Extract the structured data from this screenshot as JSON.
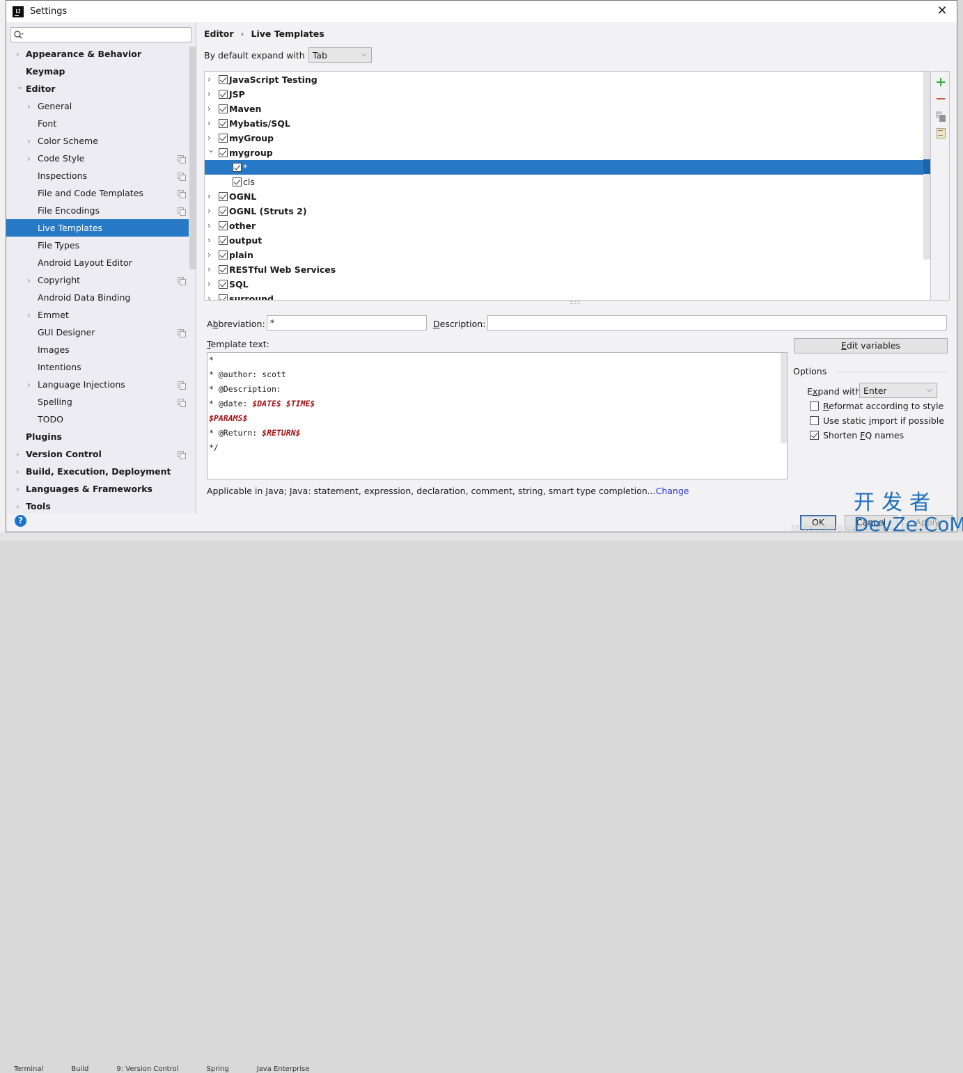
{
  "window": {
    "title": "Settings",
    "app_icon_text": "IJ",
    "close_glyph": "✕"
  },
  "sidebar": {
    "search_placeholder": "",
    "items": [
      {
        "label": "Appearance & Behavior",
        "level": 0,
        "bold": true,
        "arrow": "collapsed",
        "project_icon": false
      },
      {
        "label": "Keymap",
        "level": 0,
        "bold": true,
        "arrow": "none",
        "project_icon": false
      },
      {
        "label": "Editor",
        "level": 0,
        "bold": true,
        "arrow": "expanded",
        "project_icon": false
      },
      {
        "label": "General",
        "level": 1,
        "bold": false,
        "arrow": "collapsed",
        "project_icon": false
      },
      {
        "label": "Font",
        "level": 1,
        "bold": false,
        "arrow": "none",
        "project_icon": false
      },
      {
        "label": "Color Scheme",
        "level": 1,
        "bold": false,
        "arrow": "collapsed",
        "project_icon": false
      },
      {
        "label": "Code Style",
        "level": 1,
        "bold": false,
        "arrow": "collapsed",
        "project_icon": true
      },
      {
        "label": "Inspections",
        "level": 1,
        "bold": false,
        "arrow": "none",
        "project_icon": true
      },
      {
        "label": "File and Code Templates",
        "level": 1,
        "bold": false,
        "arrow": "none",
        "project_icon": true
      },
      {
        "label": "File Encodings",
        "level": 1,
        "bold": false,
        "arrow": "none",
        "project_icon": true
      },
      {
        "label": "Live Templates",
        "level": 1,
        "bold": false,
        "arrow": "none",
        "project_icon": false,
        "selected": true
      },
      {
        "label": "File Types",
        "level": 1,
        "bold": false,
        "arrow": "none",
        "project_icon": false
      },
      {
        "label": "Android Layout Editor",
        "level": 1,
        "bold": false,
        "arrow": "none",
        "project_icon": false
      },
      {
        "label": "Copyright",
        "level": 1,
        "bold": false,
        "arrow": "collapsed",
        "project_icon": true
      },
      {
        "label": "Android Data Binding",
        "level": 1,
        "bold": false,
        "arrow": "none",
        "project_icon": false
      },
      {
        "label": "Emmet",
        "level": 1,
        "bold": false,
        "arrow": "collapsed",
        "project_icon": false
      },
      {
        "label": "GUI Designer",
        "level": 1,
        "bold": false,
        "arrow": "none",
        "project_icon": true
      },
      {
        "label": "Images",
        "level": 1,
        "bold": false,
        "arrow": "none",
        "project_icon": false
      },
      {
        "label": "Intentions",
        "level": 1,
        "bold": false,
        "arrow": "none",
        "project_icon": false
      },
      {
        "label": "Language Injections",
        "level": 1,
        "bold": false,
        "arrow": "collapsed",
        "project_icon": true
      },
      {
        "label": "Spelling",
        "level": 1,
        "bold": false,
        "arrow": "none",
        "project_icon": true
      },
      {
        "label": "TODO",
        "level": 1,
        "bold": false,
        "arrow": "none",
        "project_icon": false
      },
      {
        "label": "Plugins",
        "level": 0,
        "bold": true,
        "arrow": "none",
        "project_icon": false
      },
      {
        "label": "Version Control",
        "level": 0,
        "bold": true,
        "arrow": "collapsed",
        "project_icon": true
      },
      {
        "label": "Build, Execution, Deployment",
        "level": 0,
        "bold": true,
        "arrow": "collapsed",
        "project_icon": false
      },
      {
        "label": "Languages & Frameworks",
        "level": 0,
        "bold": true,
        "arrow": "collapsed",
        "project_icon": false
      },
      {
        "label": "Tools",
        "level": 0,
        "bold": true,
        "arrow": "collapsed",
        "project_icon": false
      }
    ],
    "help_glyph": "?"
  },
  "main": {
    "breadcrumb": [
      "Editor",
      "Live Templates"
    ],
    "breadcrumb_sep": "›",
    "expand_label": "By default expand with",
    "expand_value": "Tab",
    "templates": [
      {
        "name": "JavaScript Testing",
        "group": true,
        "checked": true,
        "expanded": false
      },
      {
        "name": "JSP",
        "group": true,
        "checked": true,
        "expanded": false
      },
      {
        "name": "Maven",
        "group": true,
        "checked": true,
        "expanded": false
      },
      {
        "name": "Mybatis/SQL",
        "group": true,
        "checked": true,
        "expanded": false
      },
      {
        "name": "myGroup",
        "group": true,
        "checked": true,
        "expanded": false
      },
      {
        "name": "mygroup",
        "group": true,
        "checked": true,
        "expanded": true
      },
      {
        "name": "*",
        "group": false,
        "checked": true,
        "selected": true
      },
      {
        "name": "cls",
        "group": false,
        "checked": true
      },
      {
        "name": "OGNL",
        "group": true,
        "checked": true,
        "expanded": false
      },
      {
        "name": "OGNL (Struts 2)",
        "group": true,
        "checked": true,
        "expanded": false
      },
      {
        "name": "other",
        "group": true,
        "checked": true,
        "expanded": false
      },
      {
        "name": "output",
        "group": true,
        "checked": true,
        "expanded": false
      },
      {
        "name": "plain",
        "group": true,
        "checked": true,
        "expanded": false
      },
      {
        "name": "RESTful Web Services",
        "group": true,
        "checked": true,
        "expanded": false
      },
      {
        "name": "SQL",
        "group": true,
        "checked": true,
        "expanded": false
      },
      {
        "name": "surround",
        "group": true,
        "checked": true,
        "expanded": false
      }
    ],
    "tools": [
      "add-icon",
      "remove-icon",
      "copy-icon",
      "edit-doc-icon"
    ],
    "abbreviation": {
      "label_pre": "A",
      "label_u": "b",
      "label_post": "breviation:",
      "value": "*"
    },
    "description": {
      "label_u": "D",
      "label_post": "escription:",
      "value": ""
    },
    "template_text": {
      "label_u": "T",
      "label_post": "emplate text:",
      "lines": [
        [
          {
            "t": "*"
          }
        ],
        [
          {
            "t": "* @author: scott"
          }
        ],
        [
          {
            "t": "* @Description:"
          }
        ],
        [
          {
            "t": "* @date: "
          },
          {
            "t": "$DATE$",
            "var": true
          },
          {
            "t": " "
          },
          {
            "t": "$TIME$",
            "var": true
          }
        ],
        [
          {
            "t": "$PARAMS$",
            "var": true
          }
        ],
        [
          {
            "t": "* @Return: "
          },
          {
            "t": "$RETURN$",
            "var": true
          }
        ],
        [
          {
            "t": "*/"
          }
        ]
      ]
    },
    "edit_variables": {
      "u": "E",
      "rest": "dit variables"
    },
    "options": {
      "title": "Options",
      "expand_with_pre": "E",
      "expand_with_u": "x",
      "expand_with_post": "pand with",
      "expand_with_value": "Enter",
      "checkboxes": [
        {
          "u": "R",
          "rest": "eformat according to style",
          "pre": "",
          "checked": false
        },
        {
          "pre": "Use static ",
          "u": "i",
          "rest": "mport if possible",
          "checked": false
        },
        {
          "pre": "Shorten ",
          "u": "F",
          "rest": "Q names",
          "checked": true
        }
      ]
    },
    "applicable_text": "Applicable in Java; Java: statement, expression, declaration, comment, string, smart type completion...",
    "change_link": "Change",
    "buttons": {
      "ok": "OK",
      "cancel": "Cancel",
      "apply": "Apply"
    }
  },
  "overlay": {
    "watermark_cn": "开发者",
    "watermark_en": "DevZe.CoM",
    "watermark_url": "https://blog.csdn.net"
  },
  "taskbar": [
    "Terminal",
    "Build",
    "9: Version Control",
    "Spring",
    "Java Enterprise"
  ]
}
